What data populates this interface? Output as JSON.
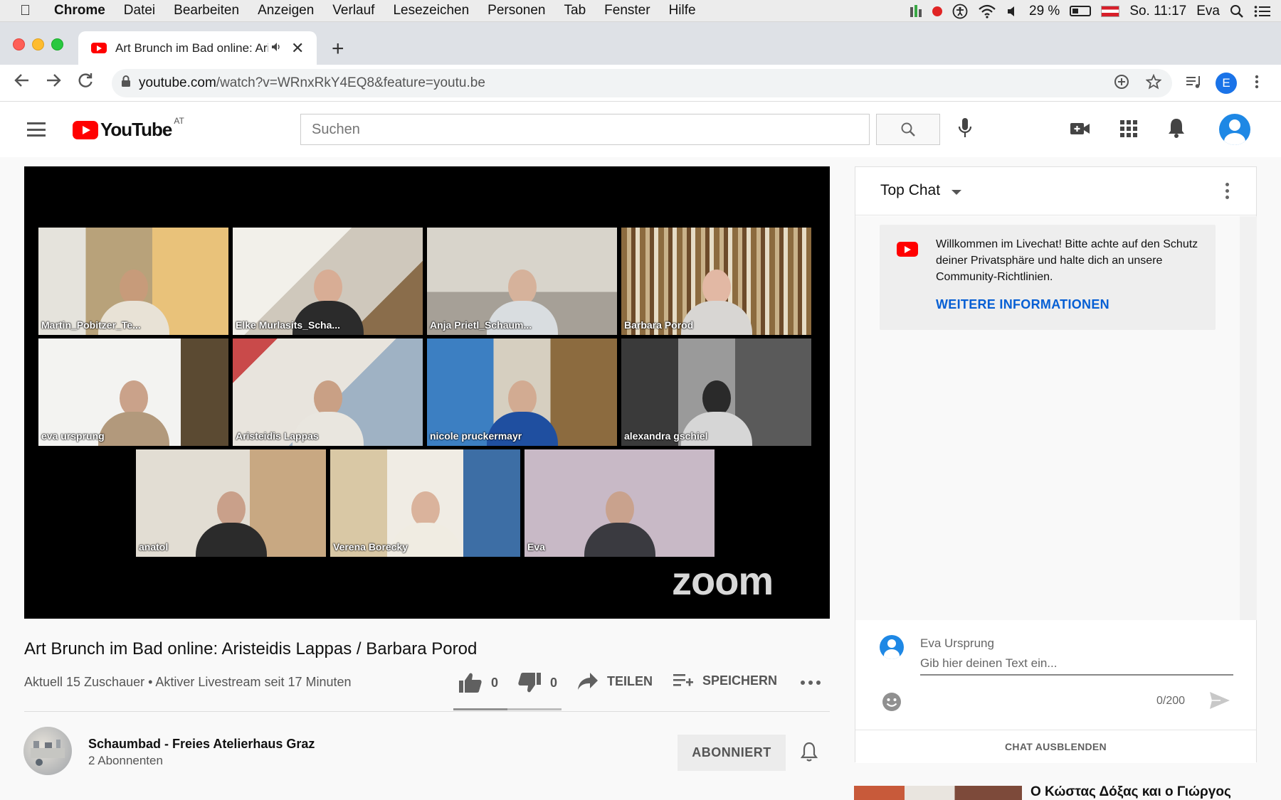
{
  "menubar": {
    "app": "Chrome",
    "items": [
      "Datei",
      "Bearbeiten",
      "Anzeigen",
      "Verlauf",
      "Lesezeichen",
      "Personen",
      "Tab",
      "Fenster",
      "Hilfe"
    ],
    "battery": "29 %",
    "clock": "So. 11:17",
    "user": "Eva"
  },
  "browser": {
    "tab_title": "Art Brunch im Bad online: Aristeidis Lappas / Barbara Porod",
    "url_host": "youtube.com",
    "url_path": "/watch?v=WRnxRkY4EQ8&feature=youtu.be",
    "profile_initial": "E"
  },
  "youtube": {
    "region": "AT",
    "search_placeholder": "Suchen"
  },
  "video": {
    "title": "Art Brunch im Bad online: Aristeidis Lappas / Barbara Porod",
    "meta": "Aktuell 15 Zuschauer • Aktiver Livestream seit 17 Minuten",
    "likes": "0",
    "dislikes": "0",
    "like_ratio": 0.5,
    "share_label": "TEILEN",
    "save_label": "SPEICHERN",
    "zoom_logo": "zoom",
    "participants": [
      "Martin_Pobitzer_Te...",
      "Elke Murlasits_Scha...",
      "Anja Prietl_Schaum...",
      "Barbara Porod",
      "eva ursprung",
      "Aristeidis Lappas",
      "nicole pruckermayr",
      "alexandra gschiel",
      "anatol",
      "Verena Borecky",
      "Eva"
    ],
    "active_speaker": "Aristeidis Lappas"
  },
  "channel": {
    "name": "Schaumbad - Freies Atelierhaus Graz",
    "subscribers": "2 Abonnenten",
    "subscribe_label": "ABONNIERT"
  },
  "chat": {
    "title": "Top Chat",
    "welcome": "Willkommen im Livechat! Bitte achte auf den Schutz deiner Privatsphäre und halte dich an unsere Community-Richtlinien.",
    "more_info": "WEITERE INFORMATIONEN",
    "user": "Eva Ursprung",
    "input_placeholder": "Gib hier deinen Text ein...",
    "char_count": "0/200",
    "hide_label": "CHAT AUSBLENDEN"
  },
  "recommendation": {
    "title": "Ο Κώστας Δόξας και ο Γιώργος"
  },
  "colors": {
    "youtube_red": "#ff0000",
    "link_blue": "#065fd4",
    "active_speaker_border": "#4dd33b"
  }
}
